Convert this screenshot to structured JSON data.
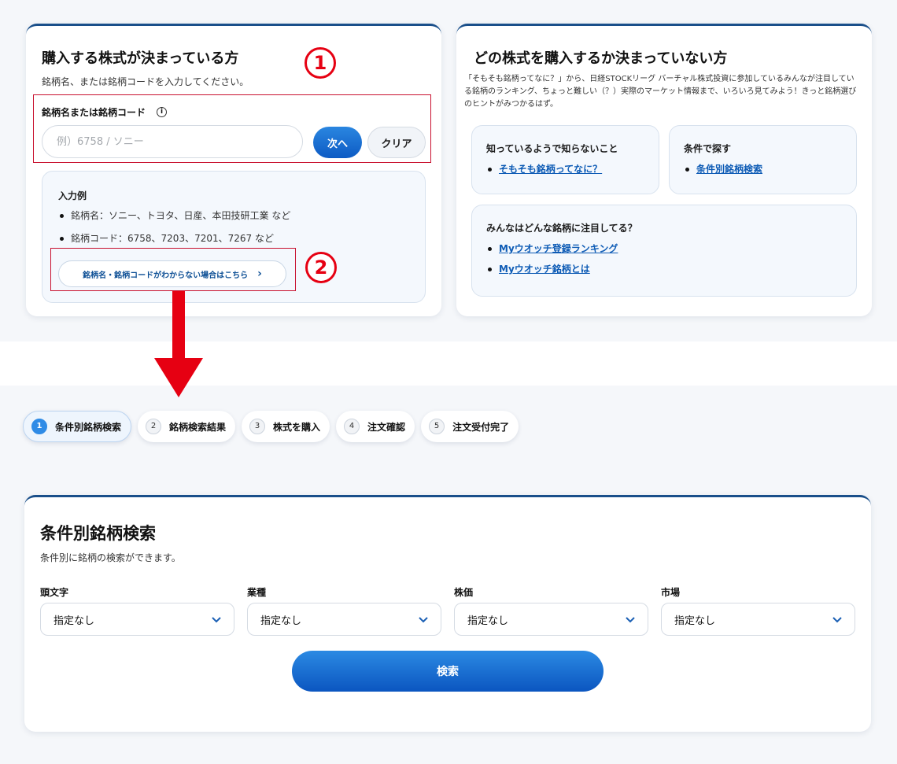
{
  "left_card": {
    "title": "購入する株式が決まっている方",
    "description": "銘柄名、または銘柄コードを入力してください。",
    "field_label": "銘柄名または銘柄コード",
    "info_glyph": "i",
    "input_placeholder": "例）6758 / ソニー",
    "next_label": "次へ",
    "clear_label": "クリア",
    "example_title": "入力例",
    "examples": [
      "銘柄名：ソニー、トヨタ、日産、本田技研工業 など",
      "銘柄コード：6758、7203、7201、7267 など"
    ],
    "help_link": "銘柄名・銘柄コードがわからない場合はこちら",
    "help_chevron": "›"
  },
  "annotations": {
    "marker_1": "1",
    "marker_2": "2",
    "accent_color": "#e60012"
  },
  "right_card": {
    "title": "どの株式を購入するか決まっていない方",
    "description": "「そもそも銘柄ってなに？」から、日経STOCKリーグ バーチャル株式投資に参加しているみんなが注目している銘柄のランキング、ちょっと難しい（？）実際のマーケット情報まで、いろいろ見てみよう！きっと銘柄選びのヒントがみつかるはず。",
    "box1": {
      "title": "知っているようで知らないこと",
      "links": [
        "そもそも銘柄ってなに？"
      ]
    },
    "box2": {
      "title": "条件で探す",
      "links": [
        "条件別銘柄検索"
      ]
    },
    "box3": {
      "title": "みんなはどんな銘柄に注目してる？",
      "links": [
        "Myウオッチ登録ランキング",
        "Myウオッチ銘柄とは"
      ]
    }
  },
  "steps": [
    {
      "num": "1",
      "label": "条件別銘柄検索",
      "active": true
    },
    {
      "num": "2",
      "label": "銘柄検索結果",
      "active": false
    },
    {
      "num": "3",
      "label": "株式を購入",
      "active": false
    },
    {
      "num": "4",
      "label": "注文確認",
      "active": false
    },
    {
      "num": "5",
      "label": "注文受付完了",
      "active": false
    }
  ],
  "search": {
    "title": "条件別銘柄検索",
    "description": "条件別に銘柄の検索ができます。",
    "filters": [
      {
        "label": "頭文字",
        "value": "指定なし"
      },
      {
        "label": "業種",
        "value": "指定なし"
      },
      {
        "label": "株価",
        "value": "指定なし"
      },
      {
        "label": "市場",
        "value": "指定なし"
      }
    ],
    "button_label": "検索"
  },
  "colors": {
    "brand_navy": "#1a4f8a",
    "primary_blue": "#0d5bc4",
    "link_blue": "#0d5bb5"
  }
}
